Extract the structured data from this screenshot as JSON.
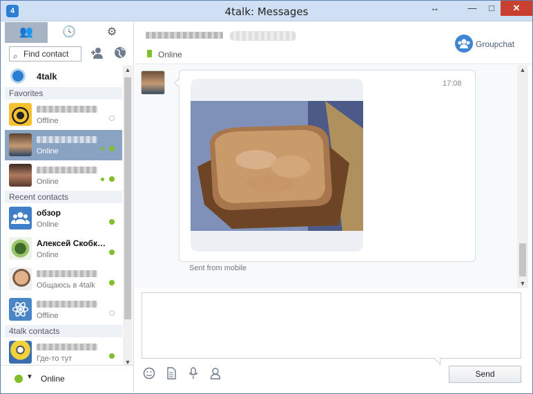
{
  "window": {
    "title": "4talk: Messages",
    "app_icon": "4talk-logo-icon",
    "controls": {
      "resize": "↔",
      "minimize": "—",
      "maximize": "□",
      "close": "✕"
    }
  },
  "sidebar": {
    "tabs": [
      {
        "name": "contacts-icon",
        "glyph": "👥"
      },
      {
        "name": "clock-icon",
        "glyph": "🕓"
      },
      {
        "name": "gear-icon",
        "glyph": "⚙"
      }
    ],
    "search": {
      "placeholder": "Find contact"
    },
    "service": {
      "label": "4talk"
    },
    "groups": {
      "favorites": "Favorites",
      "recent": "Recent contacts",
      "fourtalk": "4talk contacts"
    },
    "contacts": [
      {
        "name": "",
        "status": "Offline",
        "presence": "offline"
      },
      {
        "name": "",
        "status": "Online",
        "presence": "online",
        "selected": true
      },
      {
        "name": "",
        "status": "Online",
        "presence": "online"
      },
      {
        "name": "обзор",
        "status": "Online",
        "presence": "online"
      },
      {
        "name": "Алексей Скобк…",
        "status": "Online",
        "presence": "online"
      },
      {
        "name": "",
        "status": "Общаюсь в 4talk",
        "presence": "online"
      },
      {
        "name": "",
        "status": "Offline",
        "presence": "offline"
      },
      {
        "name": "",
        "status": "Где-то тут",
        "presence": "online"
      }
    ],
    "my_status": "Online"
  },
  "conversation": {
    "peer_status": "Online",
    "groupchat_label": "Groupchat",
    "message": {
      "time": "17:08",
      "footer": "Sent from mobile"
    }
  },
  "composer": {
    "send_label": "Send",
    "tools": [
      "smiley-icon",
      "file-icon",
      "microphone-icon",
      "contact-icon"
    ]
  },
  "colors": {
    "accent": "#2b7fd2",
    "online": "#7fbf2a",
    "selected_row": "#8aa3c2",
    "close_button": "#c8402f"
  }
}
